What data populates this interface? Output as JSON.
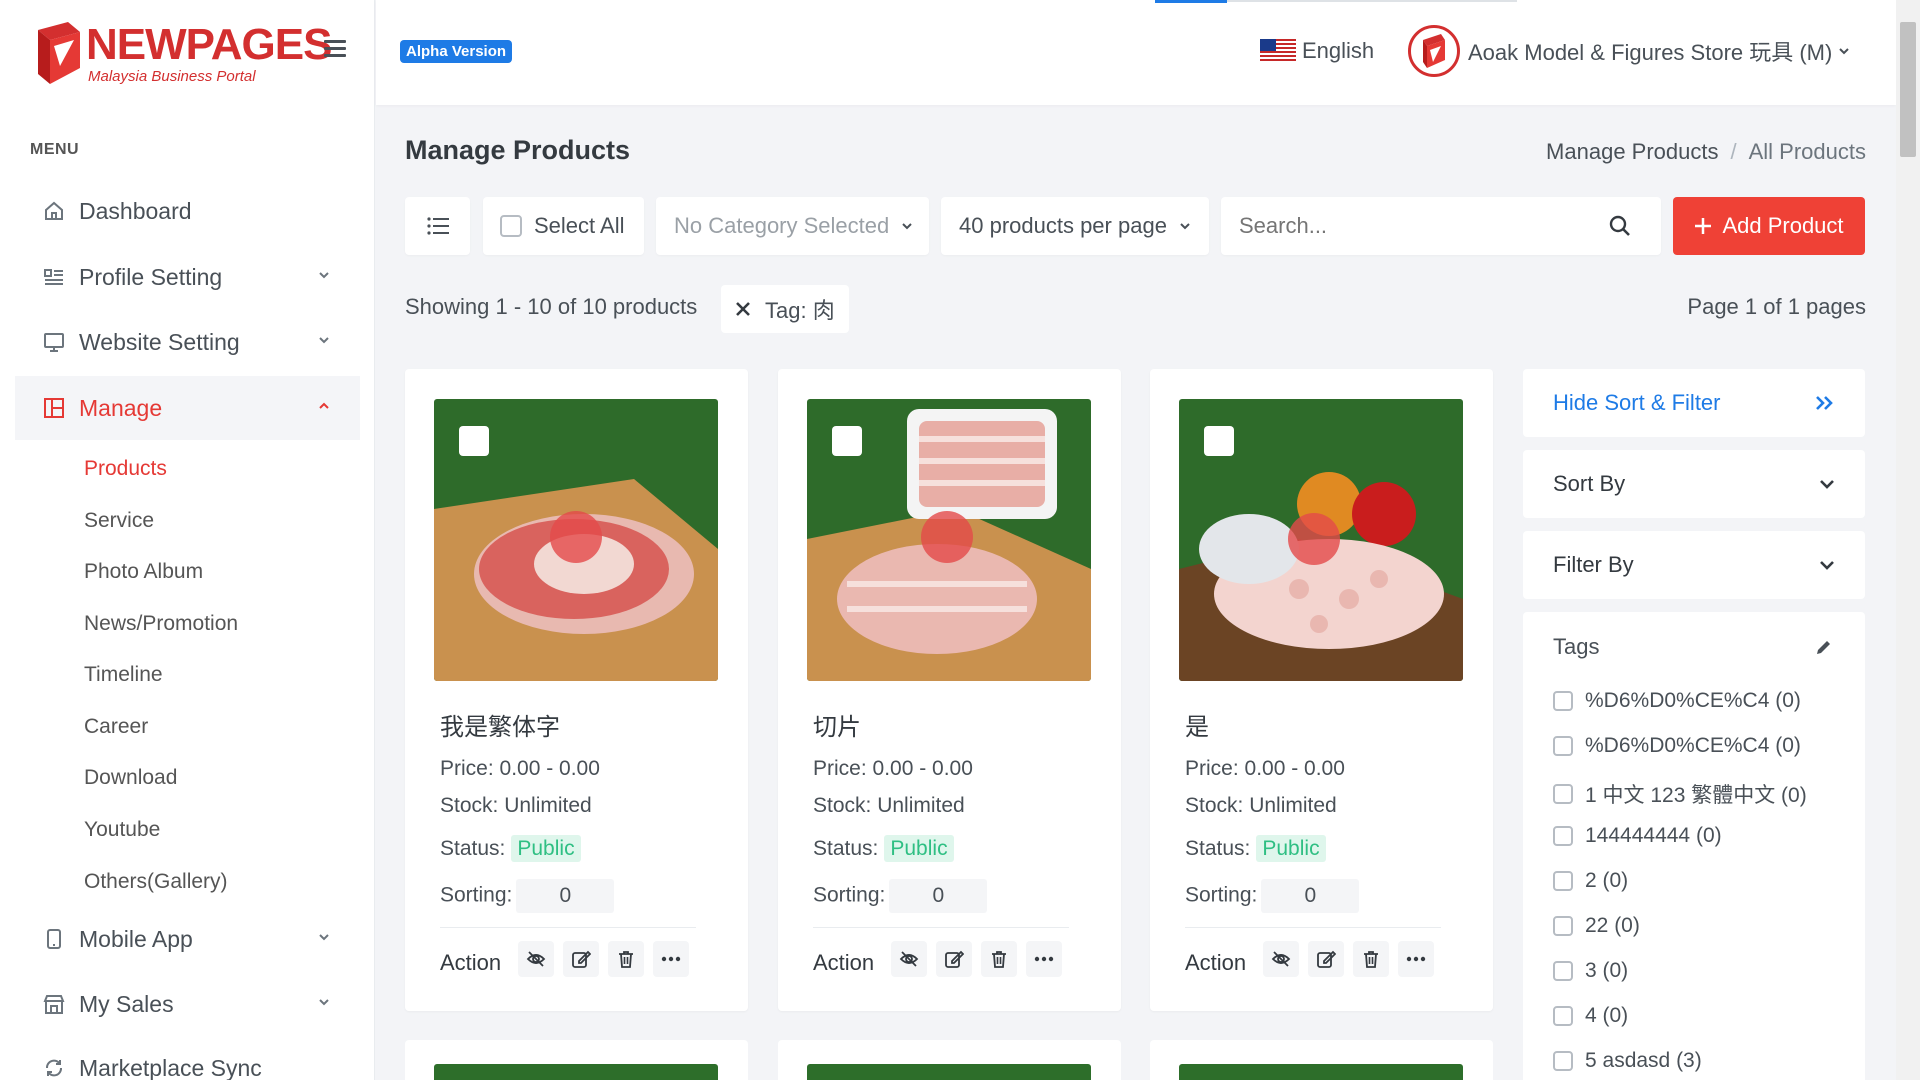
{
  "brand": {
    "name": "NEWPAGES",
    "tagline": "Malaysia Business Portal"
  },
  "sidebar": {
    "menu_title": "MENU",
    "items": [
      {
        "label": "Dashboard",
        "icon": "home-icon"
      },
      {
        "label": "Profile Setting",
        "icon": "profile-icon"
      },
      {
        "label": "Website Setting",
        "icon": "monitor-icon"
      },
      {
        "label": "Manage",
        "icon": "grid-icon"
      },
      {
        "label": "Mobile App",
        "icon": "mobile-icon"
      },
      {
        "label": "My Sales",
        "icon": "store-icon"
      },
      {
        "label": "Marketplace Sync",
        "icon": "sync-icon"
      }
    ],
    "manage_sub": [
      "Products",
      "Service",
      "Photo Album",
      "News/Promotion",
      "Timeline",
      "Career",
      "Download",
      "Youtube",
      "Others(Gallery)"
    ]
  },
  "topbar": {
    "badge": "Alpha Version",
    "language": "English",
    "store_name": "Aoak Model & Figures Store 玩具 (M)"
  },
  "page": {
    "title": "Manage Products",
    "breadcrumb": [
      "Manage Products",
      "All Products"
    ],
    "sep": "/"
  },
  "toolbar": {
    "select_all": "Select All",
    "category": "No Category Selected",
    "per_page": "40 products per page",
    "search_placeholder": "Search...",
    "add_button": "Add Product"
  },
  "filters": {
    "showing": "Showing 1 - 10 of 10 products",
    "tag_chip": "Tag: 肉",
    "page_info": "Page 1 of 1 pages"
  },
  "labels": {
    "action": "Action",
    "status_prefix": "Status:",
    "sorting_prefix": "Sorting:"
  },
  "products": [
    {
      "name": "我是繁体字",
      "price": "Price: 0.00 - 0.00",
      "stock": "Stock: Unlimited",
      "status": "Public",
      "sorting": "0"
    },
    {
      "name": "切片",
      "price": "Price: 0.00 - 0.00",
      "stock": "Stock: Unlimited",
      "status": "Public",
      "sorting": "0"
    },
    {
      "name": "是",
      "price": "Price: 0.00 - 0.00",
      "stock": "Stock: Unlimited",
      "status": "Public",
      "sorting": "0"
    }
  ],
  "sort_filter": {
    "hide": "Hide Sort & Filter",
    "sort_by": "Sort By",
    "filter_by": "Filter By",
    "tags_title": "Tags",
    "tags": [
      "%D6%D0%CE%C4 (0)",
      "%D6%D0%CE%C4 (0)",
      "1 中文 123 繁體中文 (0)",
      "144444444 (0)",
      "2 (0)",
      "22 (0)",
      "3 (0)",
      "4 (0)",
      "5 asdasd (3)"
    ]
  },
  "colors": {
    "accent": "#ef4136",
    "link": "#1e7be6",
    "status_green": "#2fbf83"
  }
}
